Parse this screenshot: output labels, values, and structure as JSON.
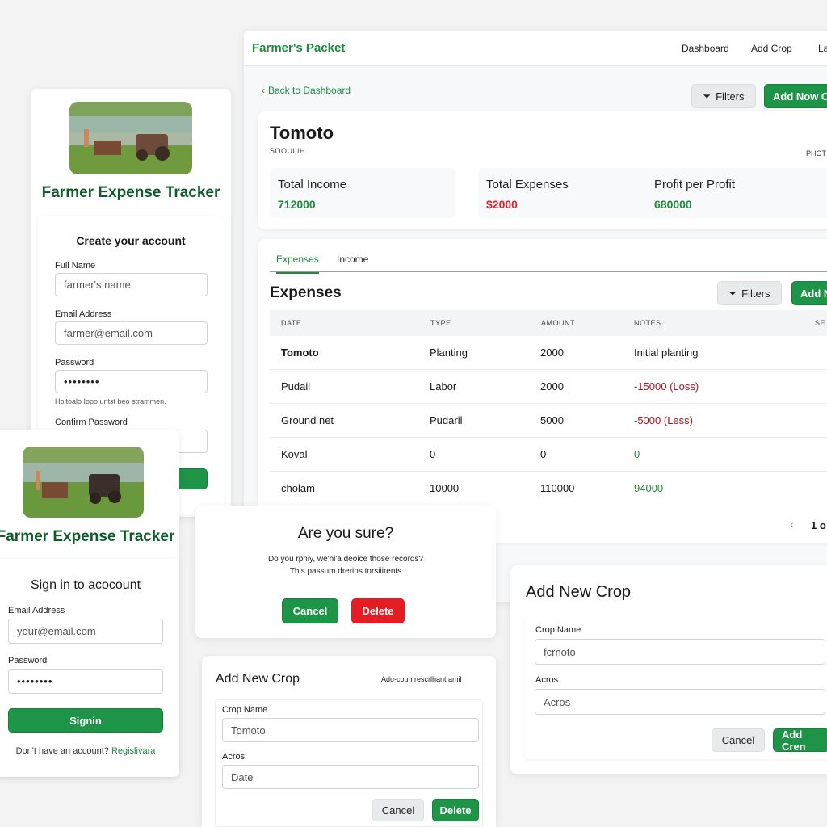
{
  "signup": {
    "app_title": "Farmer Expense Tracker",
    "heading": "Create your account",
    "full_name_label": "Full Name",
    "full_name_placeholder": "farmer's name",
    "email_label": "Email Address",
    "email_placeholder": "farmer@email.com",
    "password_label": "Password",
    "password_value": "••••••••",
    "password_hint": "Hoitoalo Iopo untst beo strammen.",
    "confirm_label": "Confirm Password"
  },
  "signin": {
    "app_title": "Farmer Expense Tracker",
    "heading": "Sign in to acocount",
    "email_label": "Email Address",
    "email_placeholder": "your@email.com",
    "password_label": "Password",
    "password_value": "••••••••",
    "submit_label": "Signin",
    "no_account_text": "Don't have an account?",
    "register_link": "Regislivara"
  },
  "dashboard": {
    "brand": "Farmer's Packet",
    "nav": [
      "Dashboard",
      "Add Crop",
      "La"
    ],
    "back_link": "Back to Dashboard",
    "filters_label": "Filters",
    "add_new_label": "Add Now C",
    "crop_title": "Tomoto",
    "crop_subtitle": "SOOULIH",
    "photo_label": "PHOT",
    "stats": [
      {
        "title": "Total Income",
        "value": "712000",
        "color": "#1d8a3e"
      },
      {
        "title": "Total Expenses",
        "value": "$2000",
        "color": "#d6262c"
      },
      {
        "title": "Profit per Profit",
        "value": "680000",
        "color": "#1d8a3e"
      }
    ],
    "tabs": [
      "Expenses",
      "Income"
    ],
    "section_title": "Expenses",
    "section_filters": "Filters",
    "section_add": "Add N",
    "columns": [
      "DATE",
      "TYPE",
      "AMOUNT",
      "NOTES",
      "SE"
    ],
    "rows": [
      {
        "date": "Tomoto",
        "type": "Planting",
        "amount": "2000",
        "notes": "Initial planting",
        "notes_color": "#1a1a1a"
      },
      {
        "date": "Pudail",
        "type": "Labor",
        "amount": "2000",
        "notes": "-15000 (Loss)",
        "notes_color": "#a8141b"
      },
      {
        "date": "Ground net",
        "type": "Pudaril",
        "amount": "5000",
        "notes": "-5000 (Less)",
        "notes_color": "#a8141b"
      },
      {
        "date": "Koval",
        "type": "0",
        "amount": "0",
        "notes": "0",
        "notes_color": "#1d8a3e"
      },
      {
        "date": "cholam",
        "type": "10000",
        "amount": "110000",
        "notes": "94000",
        "notes_color": "#1d8a3e"
      }
    ],
    "page_indicator": "1 o"
  },
  "confirm_dialog": {
    "title": "Are you sure?",
    "line1": "Do you rpniy, we'hi'a deoice those records?",
    "line2": "This passum drerins torsiiirents",
    "cancel_label": "Cancel",
    "delete_label": "Delete"
  },
  "add_crop_small": {
    "title": "Add New Crop",
    "side_note": "Adu-coun rescrlhant amil",
    "crop_name_label": "Crop Name",
    "crop_name_value": "Tomoto",
    "acros_label": "Acros",
    "acros_placeholder": "Date",
    "cancel_label": "Cancel",
    "delete_label": "Delete"
  },
  "add_crop_large": {
    "title": "Add New Crop",
    "crop_name_label": "Crop Name",
    "crop_name_value": "fcrnoto",
    "acros_label": "Acros",
    "acros_placeholder": "Acros",
    "cancel_label": "Cancel",
    "add_label": "Add Cren"
  },
  "colors": {
    "accent": "#1e9448",
    "danger": "#e41c24",
    "brand_dark": "#0f5c2a"
  }
}
